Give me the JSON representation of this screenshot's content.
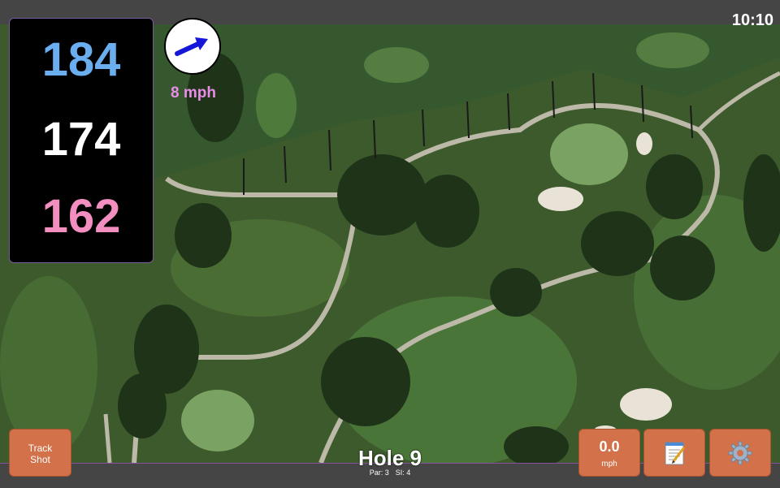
{
  "status_bar": {
    "time": "10:10"
  },
  "distances": {
    "back": "184",
    "middle": "174",
    "front": "162"
  },
  "wind": {
    "speed_label": "8 mph",
    "direction_icon": "arrow-icon"
  },
  "hole": {
    "title": "Hole 9",
    "par": "Par: 3",
    "stroke_index": "SI: 4"
  },
  "buttons": {
    "track_shot": {
      "line1": "Track",
      "line2": "Shot"
    },
    "speed": {
      "value": "0.0",
      "unit": "mph"
    },
    "notes": {
      "icon": "notepad-icon"
    },
    "settings": {
      "icon": "gear-icon"
    }
  },
  "colors": {
    "back_distance": "#6aaef0",
    "middle_distance": "#ffffff",
    "front_distance": "#f28ec0",
    "wind_label": "#e98de8",
    "button": "#d2714a"
  }
}
